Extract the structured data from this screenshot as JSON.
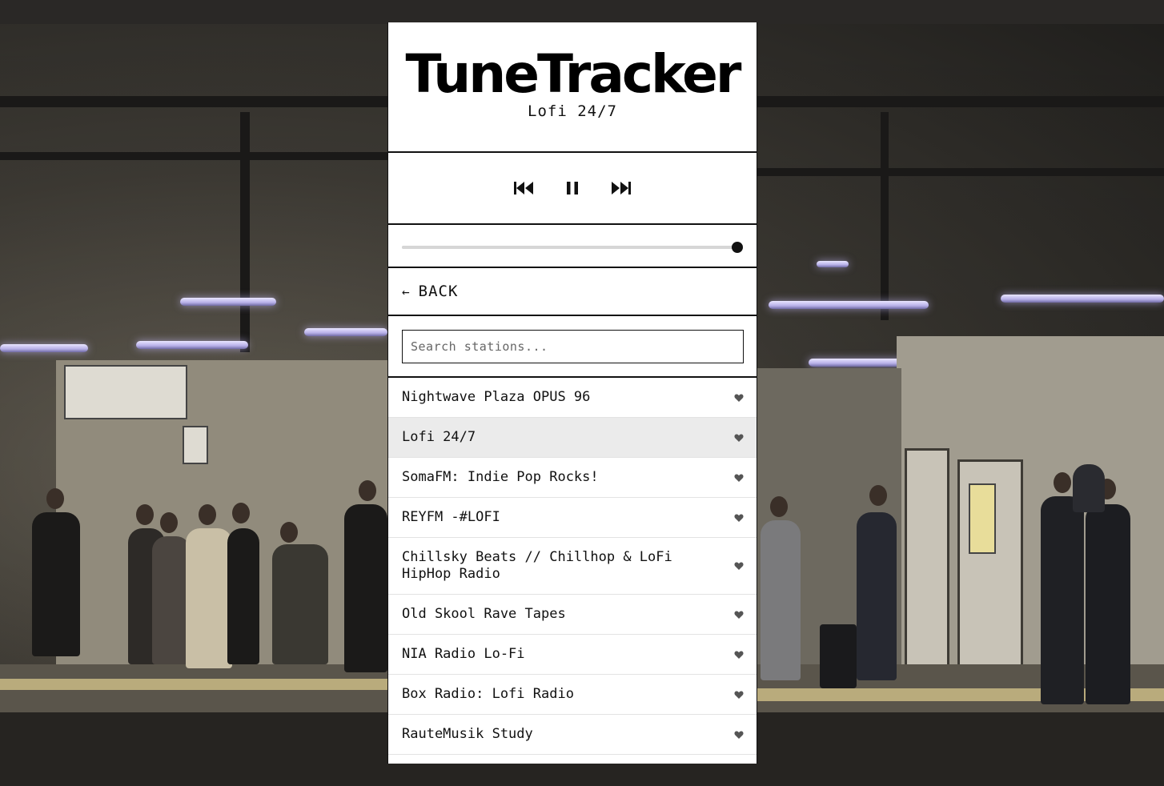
{
  "app": {
    "title": "TuneTracker",
    "now_playing": "Lofi 24/7"
  },
  "controls": {
    "previous_icon": "skip-previous-icon",
    "pause_icon": "pause-icon",
    "next_icon": "skip-next-icon"
  },
  "volume": {
    "level": 1.0
  },
  "nav": {
    "back_arrow": "←",
    "back_label": "BACK"
  },
  "search": {
    "value": "",
    "placeholder": "Search stations..."
  },
  "stations": [
    {
      "name": "Nightwave Plaza OPUS 96",
      "active": false
    },
    {
      "name": "Lofi 24/7",
      "active": true
    },
    {
      "name": "SomaFM: Indie Pop Rocks!",
      "active": false
    },
    {
      "name": "REYFM -#LOFI",
      "active": false
    },
    {
      "name": "Chillsky Beats // Chillhop & LoFi HipHop Radio",
      "active": false
    },
    {
      "name": "Old Skool Rave Tapes",
      "active": false
    },
    {
      "name": "NIA Radio Lo-Fi",
      "active": false
    },
    {
      "name": "Box Radio: Lofi Radio",
      "active": false
    },
    {
      "name": "RauteMusik Study",
      "active": false
    }
  ],
  "colors": {
    "panel_bg": "#ffffff",
    "text": "#111111",
    "active_row": "#ebebeb",
    "divider": "#111111",
    "heart": "#555555"
  }
}
